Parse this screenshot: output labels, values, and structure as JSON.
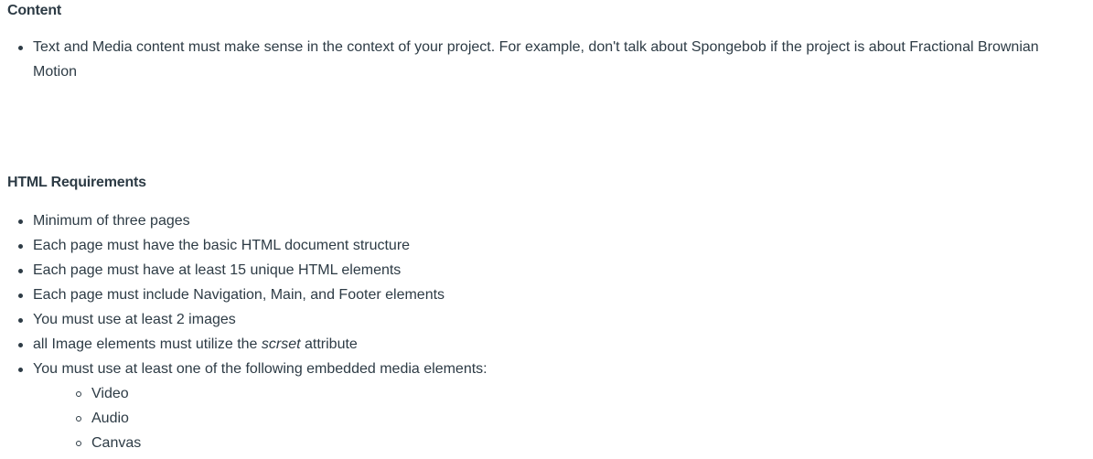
{
  "sections": [
    {
      "heading": "Content",
      "items": [
        "Text and Media content must make sense in the context of your project. For example, don't talk about Spongebob if the project is about Fractional Brownian Motion"
      ]
    },
    {
      "heading": "HTML Requirements",
      "items": [
        "Minimum of three pages",
        "Each page must have the basic HTML document structure",
        "Each page must have at least 15 unique HTML elements",
        "Each page must include Navigation, Main, and Footer elements",
        "You must use at least 2 images",
        {
          "before": "all Image elements must utilize the ",
          "emphasis": "scrset",
          "after": " attribute"
        },
        "You must use at least one of the following embedded media elements:"
      ],
      "sub_items": [
        "Video",
        "Audio",
        "Canvas"
      ]
    }
  ]
}
